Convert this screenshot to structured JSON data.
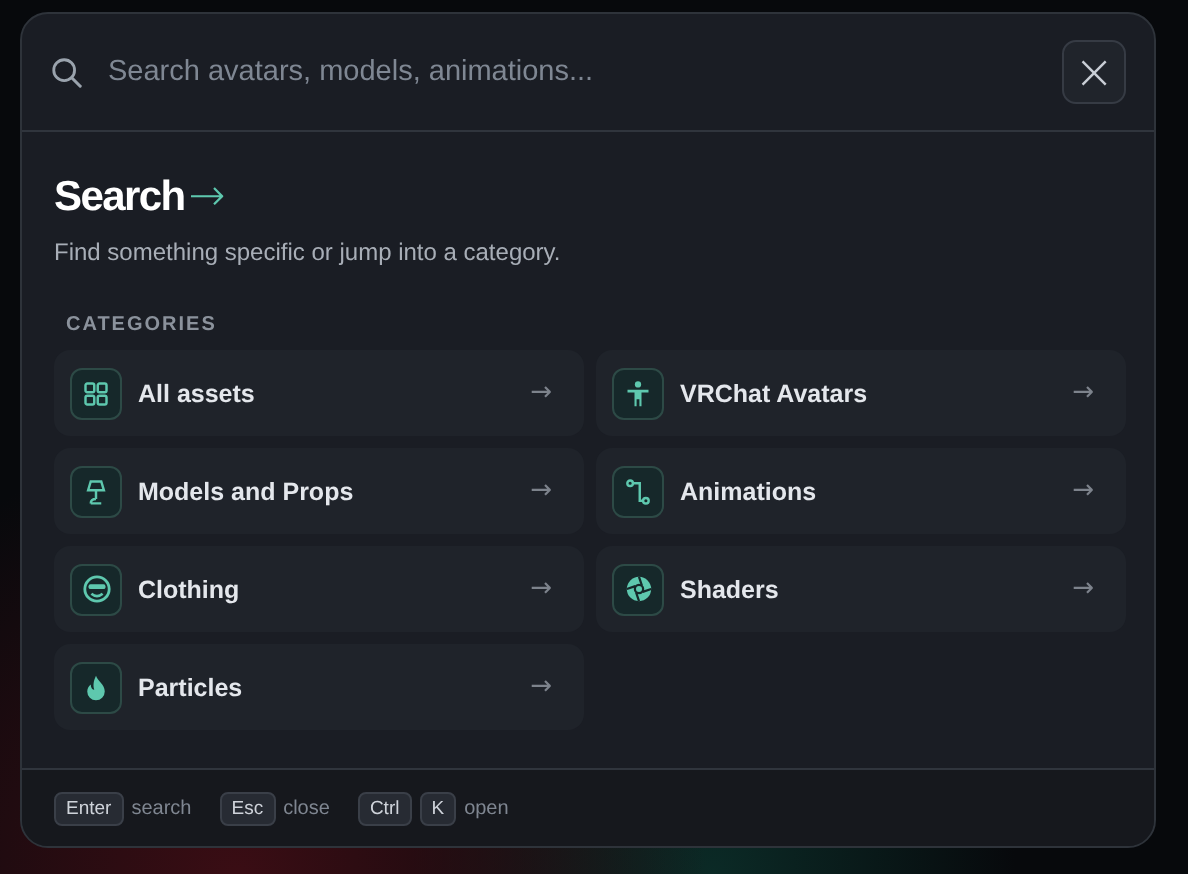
{
  "search": {
    "placeholder": "Search avatars, models, animations..."
  },
  "close_button": {
    "label": "×"
  },
  "heading": {
    "title": "Search",
    "arrow": "→",
    "subtitle": "Find something specific or jump into a category."
  },
  "categories": {
    "label": "CATEGORIES",
    "items": [
      {
        "label": "All assets",
        "arrow": "→"
      },
      {
        "label": "VRChat Avatars",
        "arrow": "→"
      },
      {
        "label": "Models and Props",
        "arrow": "→"
      },
      {
        "label": "Animations",
        "arrow": "→"
      },
      {
        "label": "Clothing",
        "arrow": "→"
      },
      {
        "label": "Shaders",
        "arrow": "→"
      },
      {
        "label": "Particles",
        "arrow": "→"
      }
    ]
  },
  "footer": [
    {
      "keys": [
        "Enter"
      ],
      "label": "search"
    },
    {
      "keys": [
        "Esc"
      ],
      "label": "close"
    },
    {
      "keys": [
        "Ctrl",
        "K"
      ],
      "label": "open"
    }
  ]
}
